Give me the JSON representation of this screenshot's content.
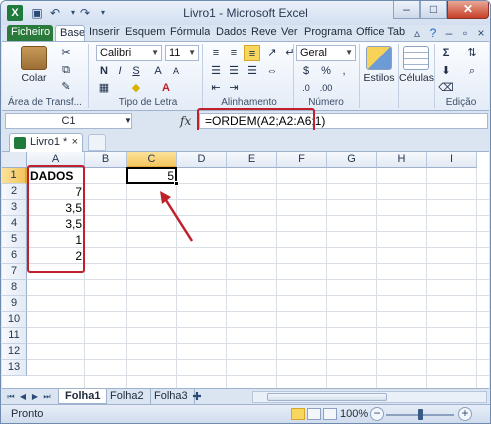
{
  "window": {
    "title": "Livro1 - Microsoft Excel",
    "app_icon": "X",
    "qat": [
      "save-icon",
      "undo-icon",
      "redo-icon"
    ]
  },
  "ribbon_tabs": [
    "Ficheiro",
    "Base",
    "Inserir",
    "Esquema d",
    "Fórmulas",
    "Dados",
    "Rever",
    "Ver",
    "Programad",
    "Office Tab"
  ],
  "ribbon": {
    "clipboard": {
      "label": "Área de Transf...",
      "paste_label": "Colar"
    },
    "font": {
      "label": "Tipo de Letra",
      "name": "Calibri",
      "size": "11"
    },
    "alignment": {
      "label": "Alinhamento"
    },
    "number": {
      "label": "Número",
      "format": "Geral"
    },
    "styles": {
      "label": "Estilos"
    },
    "cells": {
      "label": "Células"
    },
    "editing": {
      "label": "Edição"
    }
  },
  "formula_bar": {
    "name_box": "C1",
    "fx": "fx",
    "formula": "=ORDEM(A2;A2:A6;1)"
  },
  "workbook_tab": {
    "label": "Livro1 *",
    "close": "×"
  },
  "grid": {
    "columns": [
      "A",
      "B",
      "C",
      "D",
      "E",
      "F",
      "G",
      "H",
      "I"
    ],
    "rows": [
      "1",
      "2",
      "3",
      "4",
      "5",
      "6",
      "7",
      "8",
      "9",
      "10",
      "11",
      "12",
      "13"
    ],
    "cells": {
      "A1": "DADOS",
      "A2": "7",
      "A3": "3,5",
      "A4": "3,5",
      "A5": "1",
      "A6": "2",
      "C1": "5"
    },
    "selected_cell": "C1"
  },
  "sheets": [
    "Folha1",
    "Folha2",
    "Folha3"
  ],
  "active_sheet": "Folha1",
  "status": {
    "mode": "Pronto",
    "zoom": "100%",
    "zoom_value": 1.0
  },
  "colors": {
    "annotation_red": "#c0202a",
    "file_tab": "#2a7a3c",
    "selection_header": "#f3c55d"
  }
}
